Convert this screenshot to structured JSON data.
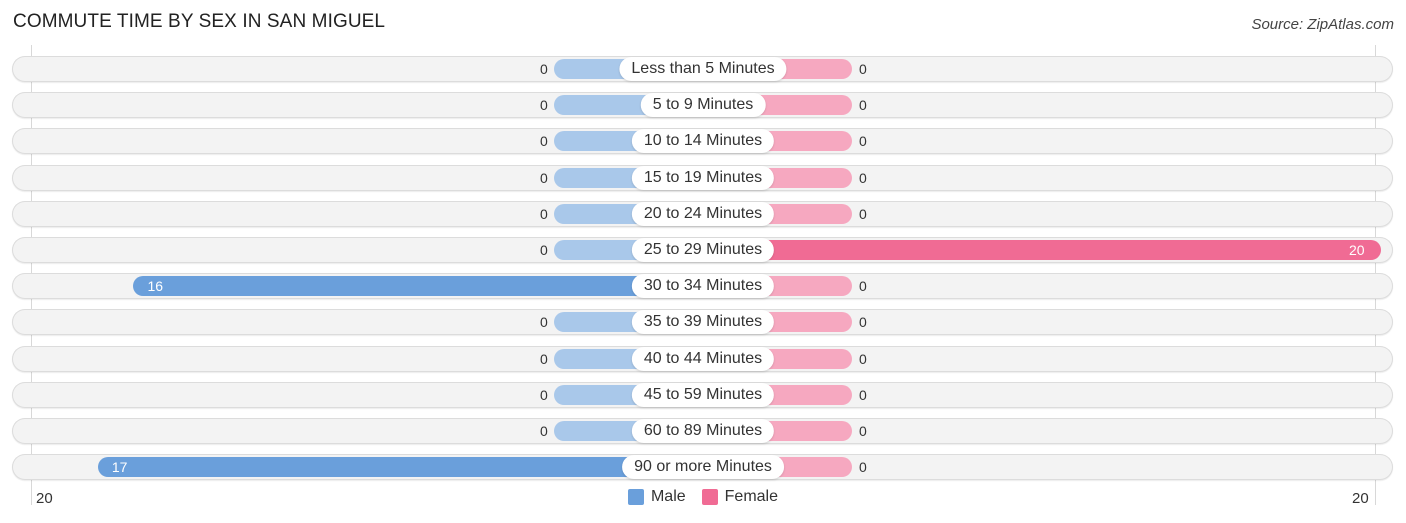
{
  "title": "COMMUTE TIME BY SEX IN SAN MIGUEL",
  "source": "Source: ZipAtlas.com",
  "colors": {
    "male": "#6a9fdb",
    "male_zero": "#a9c8ea",
    "female": "#f06b94",
    "female_zero": "#f6a8c0"
  },
  "chart_data": {
    "type": "bar",
    "orientation": "horizontal-diverging",
    "title": "COMMUTE TIME BY SEX IN SAN MIGUEL",
    "categories": [
      "Less than 5 Minutes",
      "5 to 9 Minutes",
      "10 to 14 Minutes",
      "15 to 19 Minutes",
      "20 to 24 Minutes",
      "25 to 29 Minutes",
      "30 to 34 Minutes",
      "35 to 39 Minutes",
      "40 to 44 Minutes",
      "45 to 59 Minutes",
      "60 to 89 Minutes",
      "90 or more Minutes"
    ],
    "series": [
      {
        "name": "Male",
        "values": [
          0,
          0,
          0,
          0,
          0,
          0,
          16,
          0,
          0,
          0,
          0,
          17
        ]
      },
      {
        "name": "Female",
        "values": [
          0,
          0,
          0,
          0,
          0,
          20,
          0,
          0,
          0,
          0,
          0,
          0
        ]
      }
    ],
    "axis": {
      "left_max": 20,
      "right_max": 20,
      "left_tick_label": "20",
      "right_tick_label": "20"
    },
    "legend": {
      "position": "bottom-center",
      "entries": [
        "Male",
        "Female"
      ]
    },
    "grid": false
  }
}
